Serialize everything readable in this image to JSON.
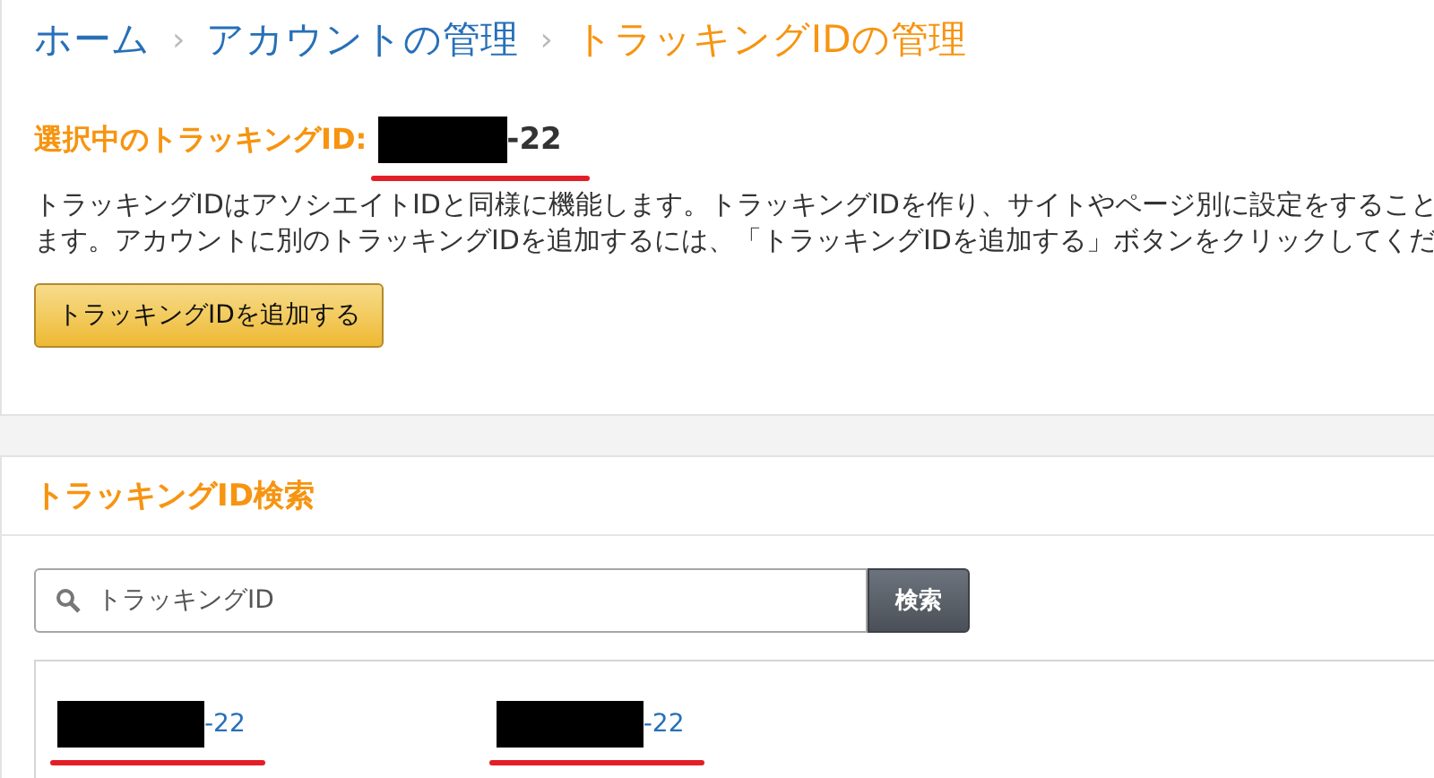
{
  "breadcrumb": [
    {
      "label": "ホーム",
      "current": false
    },
    {
      "label": "アカウントの管理",
      "current": false
    },
    {
      "label": "トラッキングIDの管理",
      "current": true
    }
  ],
  "breadcrumb_separator": "›",
  "selected_id": {
    "label": "選択中のトラッキングID:",
    "suffix": "-22"
  },
  "description": [
    "トラッキングIDはアソシエイトIDと同様に機能します。トラッキングIDを作り、サイトやページ別に設定をすること",
    "ます。アカウントに別のトラッキングIDを追加するには、「トラッキングIDを追加する」ボタンをクリックしてくだ"
  ],
  "add_button": "トラッキングIDを追加する",
  "search_section": {
    "title": "トラッキングID検索",
    "placeholder": "トラッキングID",
    "button": "検索",
    "results": [
      {
        "suffix": "-22"
      },
      {
        "suffix": "-22"
      }
    ]
  }
}
